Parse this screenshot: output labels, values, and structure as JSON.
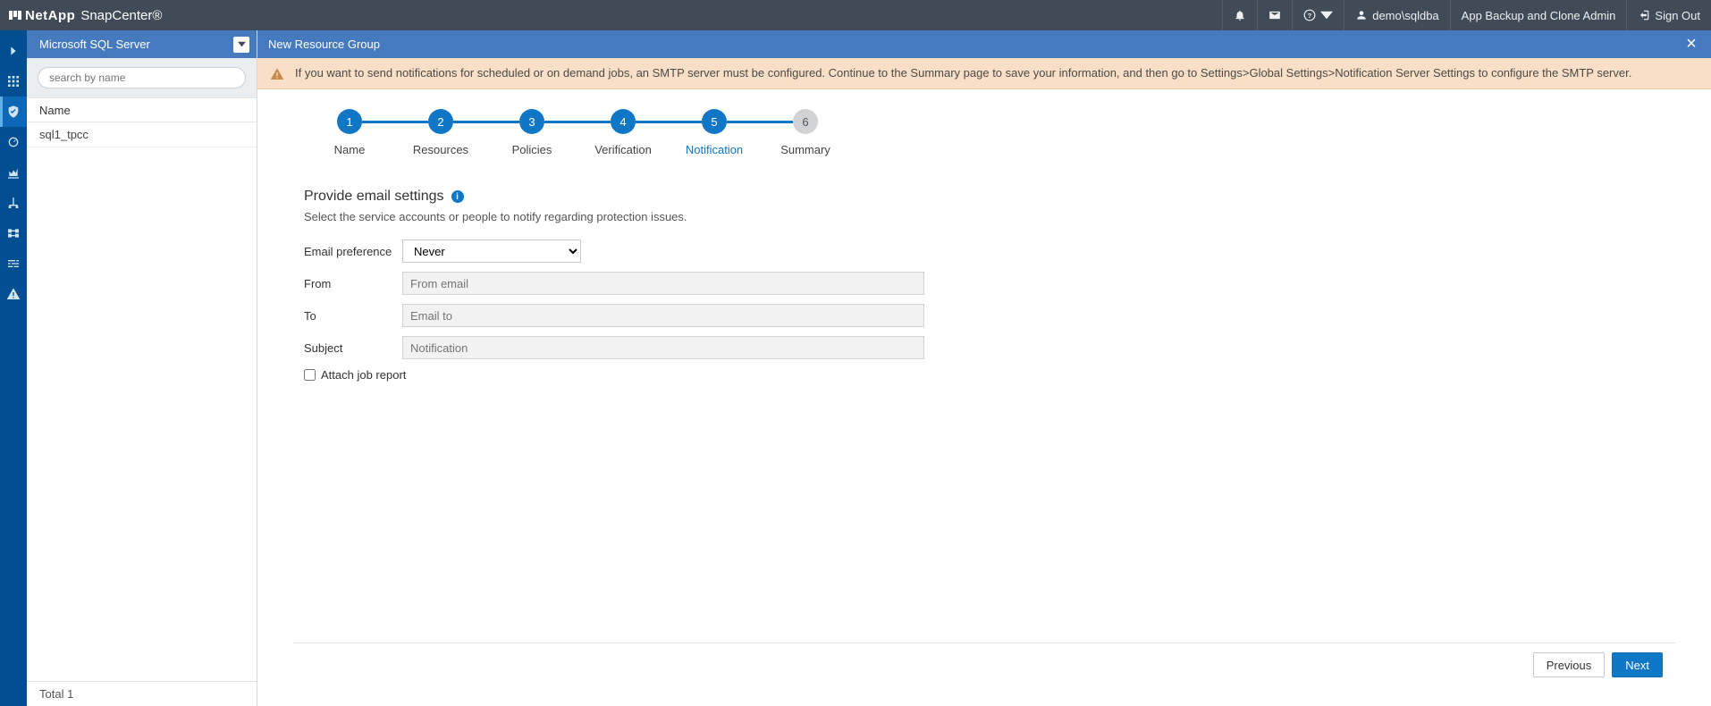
{
  "topbar": {
    "brand_company": "NetApp",
    "brand_product": "SnapCenter®",
    "user": "demo\\sqldba",
    "role": "App Backup and Clone Admin",
    "signout": "Sign Out"
  },
  "leftpanel": {
    "context": "Microsoft SQL Server",
    "search_placeholder": "search by name",
    "col_header": "Name",
    "rows": [
      "sql1_tpcc"
    ],
    "footer_total_label": "Total",
    "footer_total_value": "1"
  },
  "main": {
    "title": "New Resource Group",
    "alert": "If you want to send notifications for scheduled or on demand jobs, an SMTP server must be configured. Continue to the Summary page to save your information, and then go to Settings>Global Settings>Notification Server Settings to configure the SMTP server.",
    "stepper": [
      {
        "num": "1",
        "label": "Name"
      },
      {
        "num": "2",
        "label": "Resources"
      },
      {
        "num": "3",
        "label": "Policies"
      },
      {
        "num": "4",
        "label": "Verification"
      },
      {
        "num": "5",
        "label": "Notification",
        "active": true
      },
      {
        "num": "6",
        "label": "Summary",
        "future": true
      }
    ],
    "section_title": "Provide email settings",
    "section_sub": "Select the service accounts or people to notify regarding protection issues.",
    "form": {
      "email_pref_label": "Email preference",
      "email_pref_value": "Never",
      "from_label": "From",
      "from_placeholder": "From email",
      "to_label": "To",
      "to_placeholder": "Email to",
      "subject_label": "Subject",
      "subject_placeholder": "Notification",
      "attach_label": "Attach job report"
    },
    "buttons": {
      "previous": "Previous",
      "next": "Next"
    }
  }
}
